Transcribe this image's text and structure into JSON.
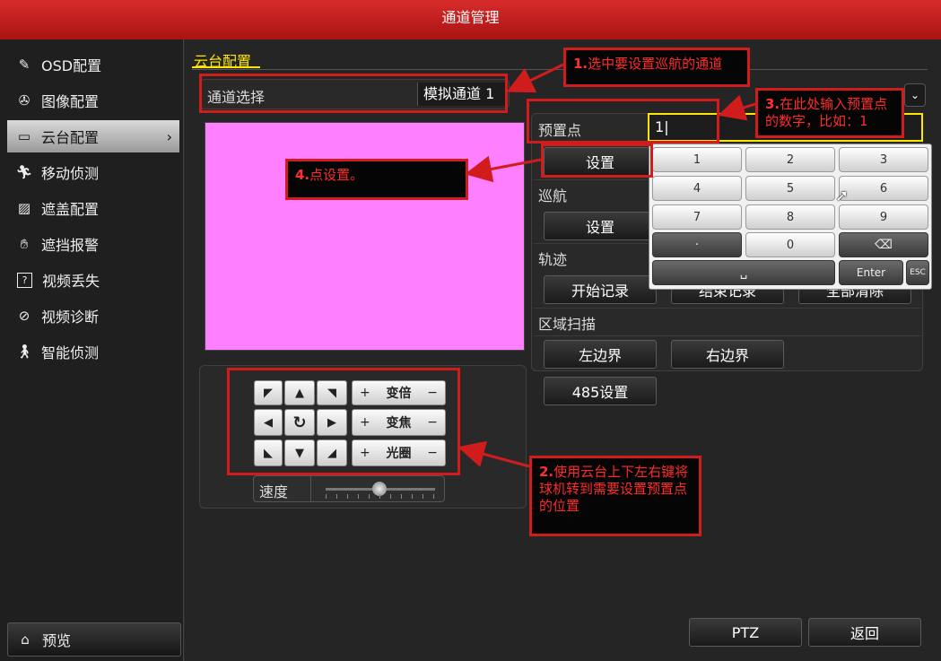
{
  "window": {
    "title": "通道管理"
  },
  "sidebar": {
    "items": [
      {
        "label": "OSD配置",
        "icon": "pen-icon"
      },
      {
        "label": "图像配置",
        "icon": "aperture-icon"
      },
      {
        "label": "云台配置",
        "icon": "ptz-camera-icon",
        "active": true
      },
      {
        "label": "移动侦测",
        "icon": "running-person-icon"
      },
      {
        "label": "遮盖配置",
        "icon": "mask-icon"
      },
      {
        "label": "遮挡报警",
        "icon": "hand-icon"
      },
      {
        "label": "视频丢失",
        "icon": "question-box-icon"
      },
      {
        "label": "视频诊断",
        "icon": "diagnosis-icon"
      },
      {
        "label": "智能侦测",
        "icon": "smart-person-icon"
      }
    ],
    "preview_label": "预览"
  },
  "main": {
    "tab_title": "云台配置",
    "channel_label": "通道选择",
    "channel_value": "模拟通道 1",
    "preset_label": "预置点",
    "preset_value": "1",
    "preset_set": "设置",
    "patrol_label": "巡航",
    "patrol_set": "设置",
    "track_label": "轨迹",
    "track_start": "开始记录",
    "track_end": "结束记录",
    "track_clear": "全部清除",
    "area_label": "区域扫描",
    "left_border": "左边界",
    "right_border": "右边界",
    "rs485": "485设置",
    "ptz": "PTZ",
    "back": "返回",
    "speed_label": "速度",
    "zoom": "变倍",
    "focus": "变焦",
    "iris": "光圈",
    "plus": "+",
    "minus": "−"
  },
  "keypad": {
    "keys": [
      "1",
      "2",
      "3",
      "4",
      "5",
      "6",
      "7",
      "8",
      "9",
      "·",
      "0"
    ],
    "enter": "Enter",
    "esc": "ESC",
    "space": "␣"
  },
  "annotations": {
    "note1_num": "1.",
    "note1_text": "选中要设置巡航的通道",
    "note2_num": "2.",
    "note2_text": "使用云台上下左右键将球机转到需要设置预置点的位置",
    "note3_num": "3.",
    "note3_text": "在此处输入预置点的数字，比如：1",
    "note4_num": "4.",
    "note4_text": "点设置。"
  },
  "colors": {
    "title_bar": "#c41e1e",
    "active_tab_text": "#ffe600",
    "video_preview": "#ff80ff",
    "annotation_red": "#d01c1c"
  }
}
